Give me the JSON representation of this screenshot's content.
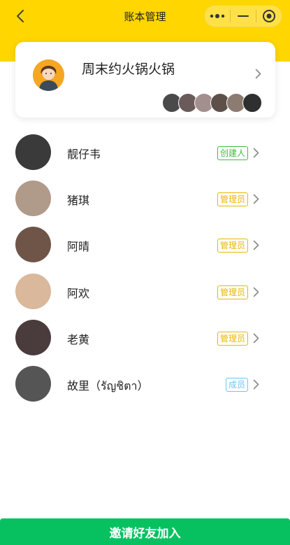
{
  "nav": {
    "title": "账本管理",
    "back_icon": "chevron-left-icon",
    "capsule_icons": [
      "more-dots-icon",
      "minimize-icon",
      "target-icon"
    ]
  },
  "group": {
    "name": "周末约火锅火锅",
    "avatar_icon": "cartoon-person-avatar",
    "member_avatar_colors": [
      "#4a4a4a",
      "#6b5a5a",
      "#a48f8f",
      "#5d5048",
      "#8c7b70",
      "#2f2f2f"
    ]
  },
  "members": [
    {
      "name": "靓仔韦",
      "role": "创建人",
      "role_type": "creator",
      "avatar_color": "#3a3a3a"
    },
    {
      "name": "猪琪",
      "role": "管理员",
      "role_type": "admin",
      "avatar_color": "#b09a8a"
    },
    {
      "name": "阿晴",
      "role": "管理员",
      "role_type": "admin",
      "avatar_color": "#6e5548"
    },
    {
      "name": "阿欢",
      "role": "管理员",
      "role_type": "admin",
      "avatar_color": "#d9b89c"
    },
    {
      "name": "老黄",
      "role": "管理员",
      "role_type": "admin",
      "avatar_color": "#4a3c3c"
    },
    {
      "name": "故里（รัญชิตา）",
      "role": "成员",
      "role_type": "member",
      "avatar_color": "#555555"
    }
  ],
  "invite_button": "邀请好友加入",
  "colors": {
    "header_bg": "#FFD600",
    "invite_bg": "#07C160",
    "creator": "#3DBE3D",
    "admin": "#E6B800",
    "member": "#6DC6EE"
  }
}
